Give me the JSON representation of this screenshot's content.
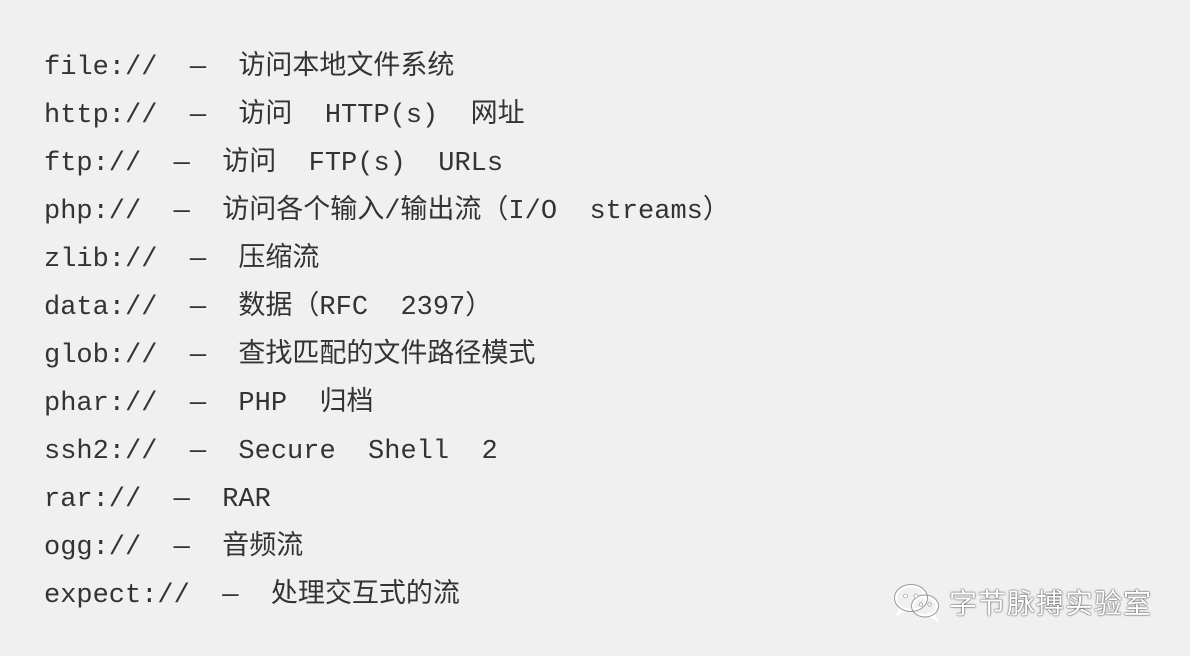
{
  "wrappers": [
    "file://  —  访问本地文件系统",
    "http://  —  访问  HTTP(s)  网址",
    "ftp://  —  访问  FTP(s)  URLs",
    "php://  —  访问各个输入/输出流（I/O  streams）",
    "zlib://  —  压缩流",
    "data://  —  数据（RFC  2397）",
    "glob://  —  查找匹配的文件路径模式",
    "phar://  —  PHP  归档",
    "ssh2://  —  Secure  Shell  2",
    "rar://  —  RAR",
    "ogg://  —  音频流",
    "expect://  —  处理交互式的流"
  ],
  "watermark": {
    "icon": "wechat-icon",
    "text": "字节脉搏实验室"
  }
}
